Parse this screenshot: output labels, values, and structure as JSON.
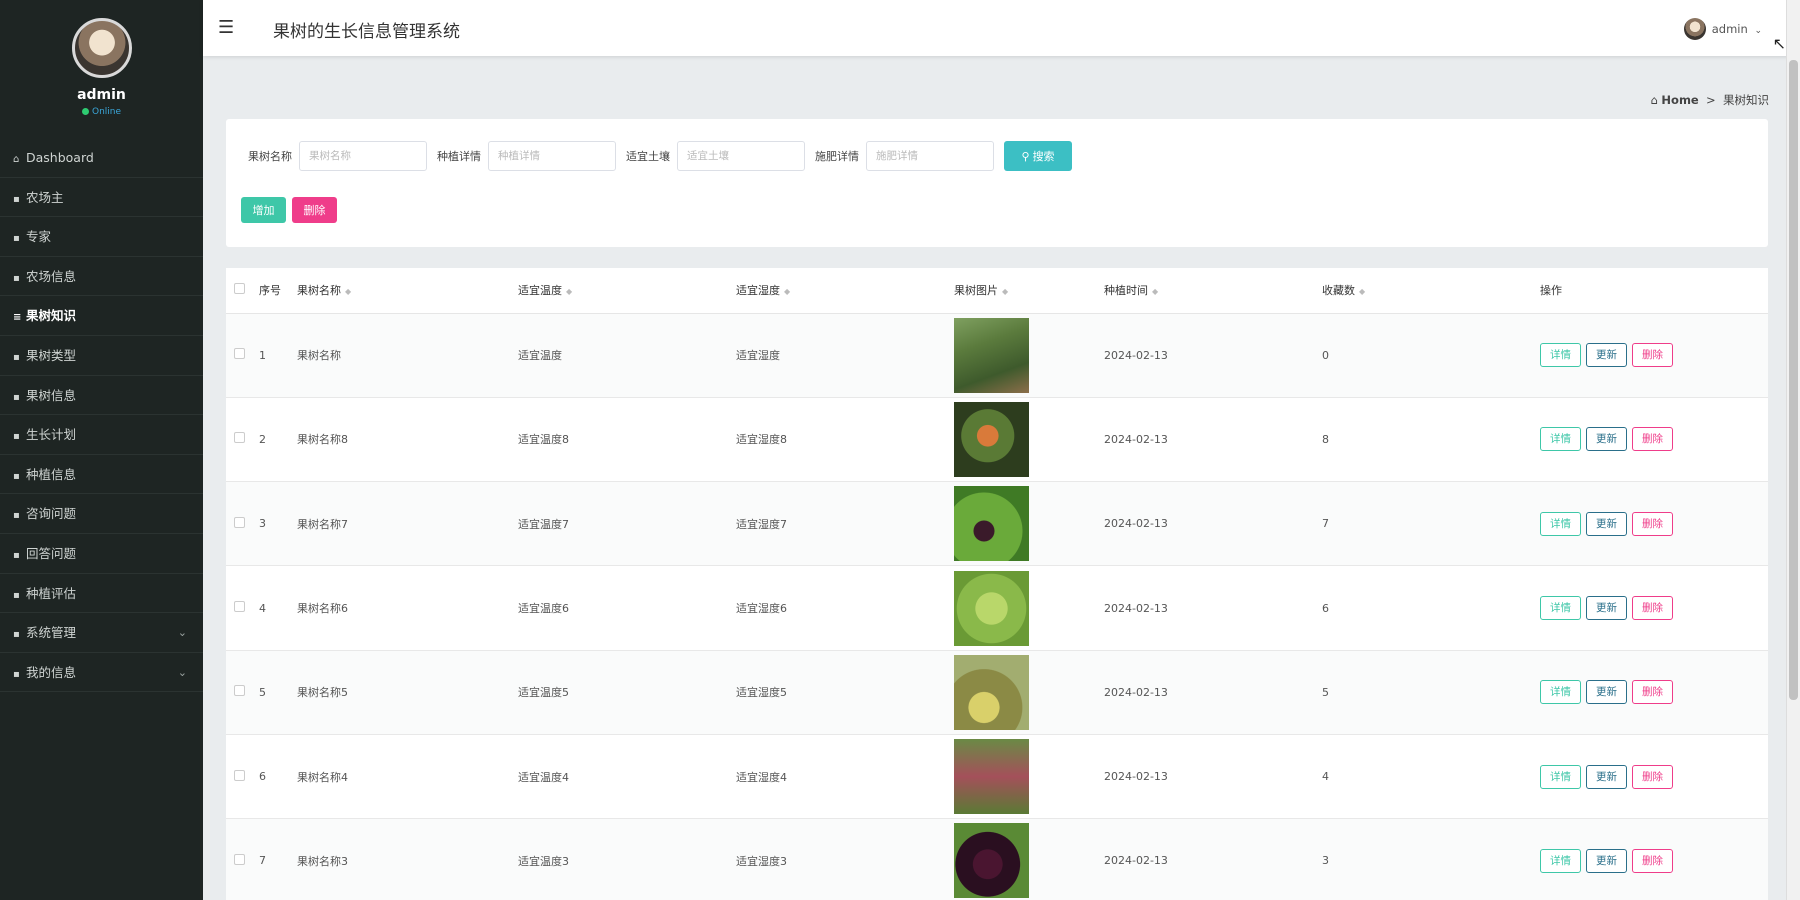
{
  "sidebar": {
    "user_name": "admin",
    "status": "Online",
    "items": [
      {
        "label": "Dashboard",
        "icon": "⌂"
      },
      {
        "label": "农场主",
        "icon": "▪"
      },
      {
        "label": "专家",
        "icon": "▪"
      },
      {
        "label": "农场信息",
        "icon": "▪"
      },
      {
        "label": "果树知识",
        "icon": "≡"
      },
      {
        "label": "果树类型",
        "icon": "▪"
      },
      {
        "label": "果树信息",
        "icon": "▪"
      },
      {
        "label": "生长计划",
        "icon": "▪"
      },
      {
        "label": "种植信息",
        "icon": "▪"
      },
      {
        "label": "咨询问题",
        "icon": "▪"
      },
      {
        "label": "回答问题",
        "icon": "▪"
      },
      {
        "label": "种植评估",
        "icon": "▪"
      },
      {
        "label": "系统管理",
        "icon": "▪"
      },
      {
        "label": "我的信息",
        "icon": "▪"
      }
    ]
  },
  "header": {
    "title": "果树的生长信息管理系统",
    "user": "admin"
  },
  "breadcrumb": {
    "home": "Home",
    "separator": ">",
    "current": "果树知识"
  },
  "search": {
    "fields": [
      {
        "label": "果树名称",
        "placeholder": "果树名称"
      },
      {
        "label": "种植详情",
        "placeholder": "种植详情"
      },
      {
        "label": "适宜土壤",
        "placeholder": "适宜土壤"
      },
      {
        "label": "施肥详情",
        "placeholder": "施肥详情"
      }
    ],
    "search_button": "搜索",
    "add_button": "增加",
    "delete_button": "删除"
  },
  "table": {
    "columns": [
      "序号",
      "果树名称",
      "适宜温度",
      "适宜湿度",
      "果树图片",
      "种植时间",
      "收藏数",
      "操作"
    ],
    "action_labels": {
      "detail": "详情",
      "update": "更新",
      "delete": "删除"
    },
    "rows": [
      {
        "index": "1",
        "name": "果树名称",
        "temp": "适宜温度",
        "humidity": "适宜湿度",
        "date": "2024-02-13",
        "favorites": "0"
      },
      {
        "index": "2",
        "name": "果树名称8",
        "temp": "适宜温度8",
        "humidity": "适宜湿度8",
        "date": "2024-02-13",
        "favorites": "8"
      },
      {
        "index": "3",
        "name": "果树名称7",
        "temp": "适宜温度7",
        "humidity": "适宜湿度7",
        "date": "2024-02-13",
        "favorites": "7"
      },
      {
        "index": "4",
        "name": "果树名称6",
        "temp": "适宜温度6",
        "humidity": "适宜湿度6",
        "date": "2024-02-13",
        "favorites": "6"
      },
      {
        "index": "5",
        "name": "果树名称5",
        "temp": "适宜温度5",
        "humidity": "适宜湿度5",
        "date": "2024-02-13",
        "favorites": "5"
      },
      {
        "index": "6",
        "name": "果树名称4",
        "temp": "适宜温度4",
        "humidity": "适宜湿度4",
        "date": "2024-02-13",
        "favorites": "4"
      },
      {
        "index": "7",
        "name": "果树名称3",
        "temp": "适宜温度3",
        "humidity": "适宜湿度3",
        "date": "2024-02-13",
        "favorites": "3"
      }
    ]
  },
  "colors": {
    "sidebar_bg": "#1e2523",
    "search_btn": "#3cbfc4",
    "add_btn": "#3ec7a8",
    "delete_btn": "#ef3d8a"
  }
}
